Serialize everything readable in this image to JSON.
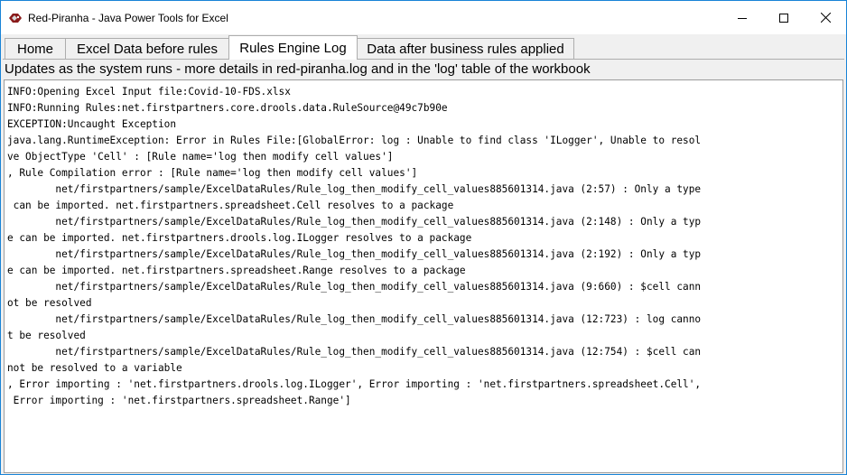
{
  "window": {
    "title": "Red-Piranha - Java Power Tools for Excel",
    "icon": "red-piranha-app-icon",
    "controls": [
      "minimize-icon",
      "maximize-icon",
      "close-icon"
    ]
  },
  "tabs": [
    {
      "label": "Home",
      "active": false
    },
    {
      "label": "Excel Data before rules",
      "active": false
    },
    {
      "label": "Rules Engine Log",
      "active": true
    },
    {
      "label": "Data after business rules applied",
      "active": false
    }
  ],
  "info_text": "Updates as the system runs - more details in red-piranha.log and in the 'log' table of the workbook",
  "log_lines": [
    "INFO:Opening Excel Input file:Covid-10-FDS.xlsx",
    "INFO:Running Rules:net.firstpartners.core.drools.data.RuleSource@49c7b90e",
    "EXCEPTION:Uncaught Exception",
    "java.lang.RuntimeException: Error in Rules File:[GlobalError: log : Unable to find class 'ILogger', Unable to resol",
    "ve ObjectType 'Cell' : [Rule name='log then modify cell values']",
    ", Rule Compilation error : [Rule name='log then modify cell values']",
    "        net/firstpartners/sample/ExcelDataRules/Rule_log_then_modify_cell_values885601314.java (2:57) : Only a type",
    " can be imported. net.firstpartners.spreadsheet.Cell resolves to a package",
    "        net/firstpartners/sample/ExcelDataRules/Rule_log_then_modify_cell_values885601314.java (2:148) : Only a typ",
    "e can be imported. net.firstpartners.drools.log.ILogger resolves to a package",
    "        net/firstpartners/sample/ExcelDataRules/Rule_log_then_modify_cell_values885601314.java (2:192) : Only a typ",
    "e can be imported. net.firstpartners.spreadsheet.Range resolves to a package",
    "        net/firstpartners/sample/ExcelDataRules/Rule_log_then_modify_cell_values885601314.java (9:660) : $cell cann",
    "ot be resolved",
    "        net/firstpartners/sample/ExcelDataRules/Rule_log_then_modify_cell_values885601314.java (12:723) : log canno",
    "t be resolved",
    "        net/firstpartners/sample/ExcelDataRules/Rule_log_then_modify_cell_values885601314.java (12:754) : $cell can",
    "not be resolved to a variable",
    ", Error importing : 'net.firstpartners.drools.log.ILogger', Error importing : 'net.firstpartners.spreadsheet.Cell',",
    " Error importing : 'net.firstpartners.spreadsheet.Range']"
  ]
}
